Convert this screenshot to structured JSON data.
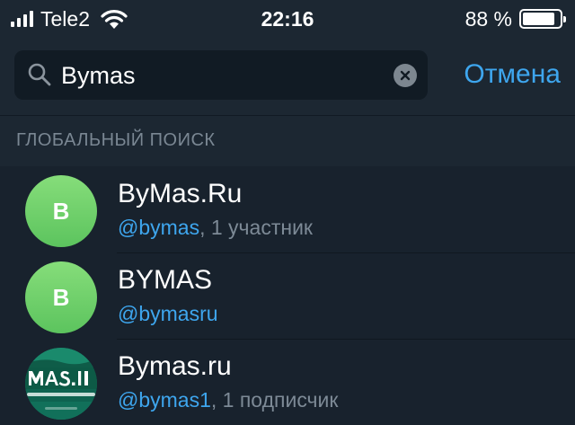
{
  "status_bar": {
    "carrier": "Tele2",
    "time": "22:16",
    "battery_percent": "88 %",
    "battery_level": 0.88
  },
  "search": {
    "query": "Bymas",
    "cancel_label": "Отмена"
  },
  "section": {
    "title": "ГЛОБАЛЬНЫЙ ПОИСК"
  },
  "results": [
    {
      "title": "ByMas.Ru",
      "handle": "@bymas",
      "meta": ", 1 участник",
      "avatar_letter": "B"
    },
    {
      "title": "BYMAS",
      "handle": "@bymasru",
      "meta": "",
      "avatar_letter": "B"
    },
    {
      "title": "Bymas.ru",
      "handle": "@bymas1",
      "meta": ", 1 подписчик"
    }
  ],
  "colors": {
    "accent": "#3ea6ee",
    "background": "#18222d",
    "avatar_green": "#6fd06c"
  }
}
